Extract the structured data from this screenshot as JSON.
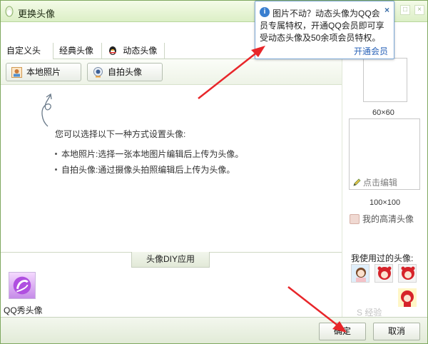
{
  "window": {
    "title": "更换头像",
    "controls": [
      "_",
      "□",
      "×"
    ]
  },
  "tabs": [
    {
      "label": "自定义头像"
    },
    {
      "label": "经典头像"
    },
    {
      "label": "动态头像",
      "icon": "qq-penguin-icon"
    }
  ],
  "toolbar": {
    "local_photo_label": "本地照片",
    "selfie_label": "自拍头像"
  },
  "content": {
    "intro": "您可以选择以下一种方式设置头像:",
    "bullets": [
      "本地照片:选择一张本地图片编辑后上传为头像。",
      "自拍头像:通过摄像头拍照编辑后上传为头像。"
    ]
  },
  "diy": {
    "tab_label": "头像DIY应用",
    "qqshow_label": "QQ秀头像"
  },
  "side": {
    "label_60": "60×60",
    "edit_link": "点击编辑",
    "label_100": "100×100",
    "hd_avatar": "我的高清头像",
    "used_title": "我使用过的头像:"
  },
  "tooltip": {
    "lines": [
      "图片不动？动态头像为QQ会",
      "员专属特权，开通QQ会员即可享",
      "受动态头像及50余项会员特权。"
    ],
    "link": "开通会员",
    "close": "×"
  },
  "footer": {
    "ok_label": "确定",
    "cancel_label": "取消"
  },
  "watermark": "S 经验",
  "colors": {
    "accent_green": "#7fa860",
    "tooltip_border": "#7aa7d6",
    "link_blue": "#2a63b8",
    "annotation_red": "#e8262a"
  }
}
